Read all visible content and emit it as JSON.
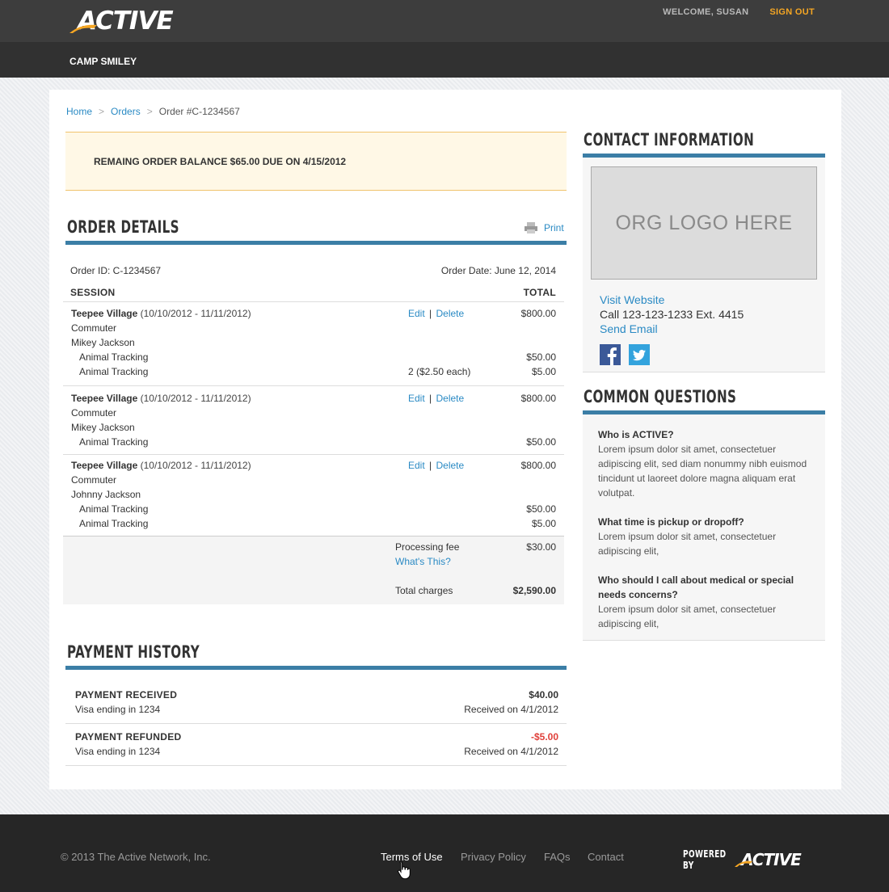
{
  "header": {
    "logo_text": "ACTIVE",
    "welcome": "WELCOME, SUSAN",
    "signout": "SIGN OUT",
    "camp": "CAMP SMILEY"
  },
  "breadcrumb": {
    "home": "Home",
    "orders": "Orders",
    "current": "Order #C-1234567",
    "separator": ">"
  },
  "alert": {
    "text": "REMAING ORDER BALANCE $65.00 DUE ON 4/15/2012"
  },
  "order_details": {
    "title": "ORDER DETAILS",
    "print_label": "Print",
    "order_id": "Order ID: C-1234567",
    "order_date": "Order Date: June 12, 2014",
    "col_session": "SESSION",
    "col_total": "TOTAL",
    "edit_label": "Edit",
    "delete_label": "Delete",
    "action_sep": "|",
    "items": [
      {
        "session": "Teepee Village",
        "dates": "(10/10/2012 - 11/11/2012)",
        "amount": "$800.00",
        "type": "Commuter",
        "participant": "Mikey Jackson",
        "addons": [
          {
            "name": "Animal Tracking",
            "qty": "",
            "amount": "$50.00"
          },
          {
            "name": "Animal Tracking",
            "qty": "2 ($2.50 each)",
            "amount": "$5.00"
          }
        ]
      },
      {
        "session": "Teepee Village",
        "dates": "(10/10/2012 - 11/11/2012)",
        "amount": "$800.00",
        "type": "Commuter",
        "participant": "Mikey Jackson",
        "addons": [
          {
            "name": "Animal Tracking",
            "qty": "",
            "amount": "$50.00"
          }
        ]
      },
      {
        "session": "Teepee Village",
        "dates": "(10/10/2012 - 11/11/2012)",
        "amount": "$800.00",
        "type": "Commuter",
        "participant": "Johnny Jackson",
        "addons": [
          {
            "name": "Animal Tracking",
            "qty": "",
            "amount": "$50.00"
          },
          {
            "name": "Animal Tracking",
            "qty": "",
            "amount": "$5.00"
          }
        ]
      }
    ],
    "processing_fee_label": "Processing fee",
    "processing_fee": "$30.00",
    "whats_this": "What's This?",
    "total_label": "Total charges",
    "total": "$2,590.00"
  },
  "payment_history": {
    "title": "PAYMENT HISTORY",
    "payments": [
      {
        "title": "PAYMENT RECEIVED",
        "method": "Visa ending in 1234",
        "amount": "$40.00",
        "received": "Received on 4/1/2012",
        "negative": false
      },
      {
        "title": "PAYMENT REFUNDED",
        "method": "Visa ending in 1234",
        "amount": "-$5.00",
        "received": "Received on 4/1/2012",
        "negative": true
      }
    ]
  },
  "contact": {
    "title": "CONTACT INFORMATION",
    "logo_placeholder": "ORG LOGO HERE",
    "visit_website": "Visit Website",
    "phone": "Call 123-123-1233  Ext. 4415",
    "send_email": "Send Email",
    "facebook_icon": "facebook-icon",
    "twitter_icon": "twitter-icon"
  },
  "faq": {
    "title": "COMMON QUESTIONS",
    "items": [
      {
        "q": "Who is ACTIVE?",
        "a": "Lorem ipsum dolor sit amet, consectetuer adipiscing elit, sed diam nonummy nibh euismod tincidunt ut laoreet dolore magna aliquam erat volutpat."
      },
      {
        "q": "What time is pickup or dropoff?",
        "a": "Lorem ipsum dolor sit amet, consectetuer adipiscing elit,"
      },
      {
        "q": "Who should I call about medical or special needs concerns?",
        "a": "Lorem ipsum dolor sit amet, consectetuer adipiscing elit,"
      }
    ]
  },
  "footer": {
    "copyright": "© 2013 The Active Network, Inc.",
    "links": [
      "Terms of Use",
      "Privacy Policy",
      "FAQs",
      "Contact"
    ],
    "powered_by": "POWERED BY",
    "powered_logo": "ACTIVE"
  },
  "colors": {
    "accent_blue": "#3b7ea6",
    "link": "#2a8ac4",
    "signout": "#f5a623",
    "refund": "#e0403a",
    "alert_bg": "#fff8e6"
  }
}
